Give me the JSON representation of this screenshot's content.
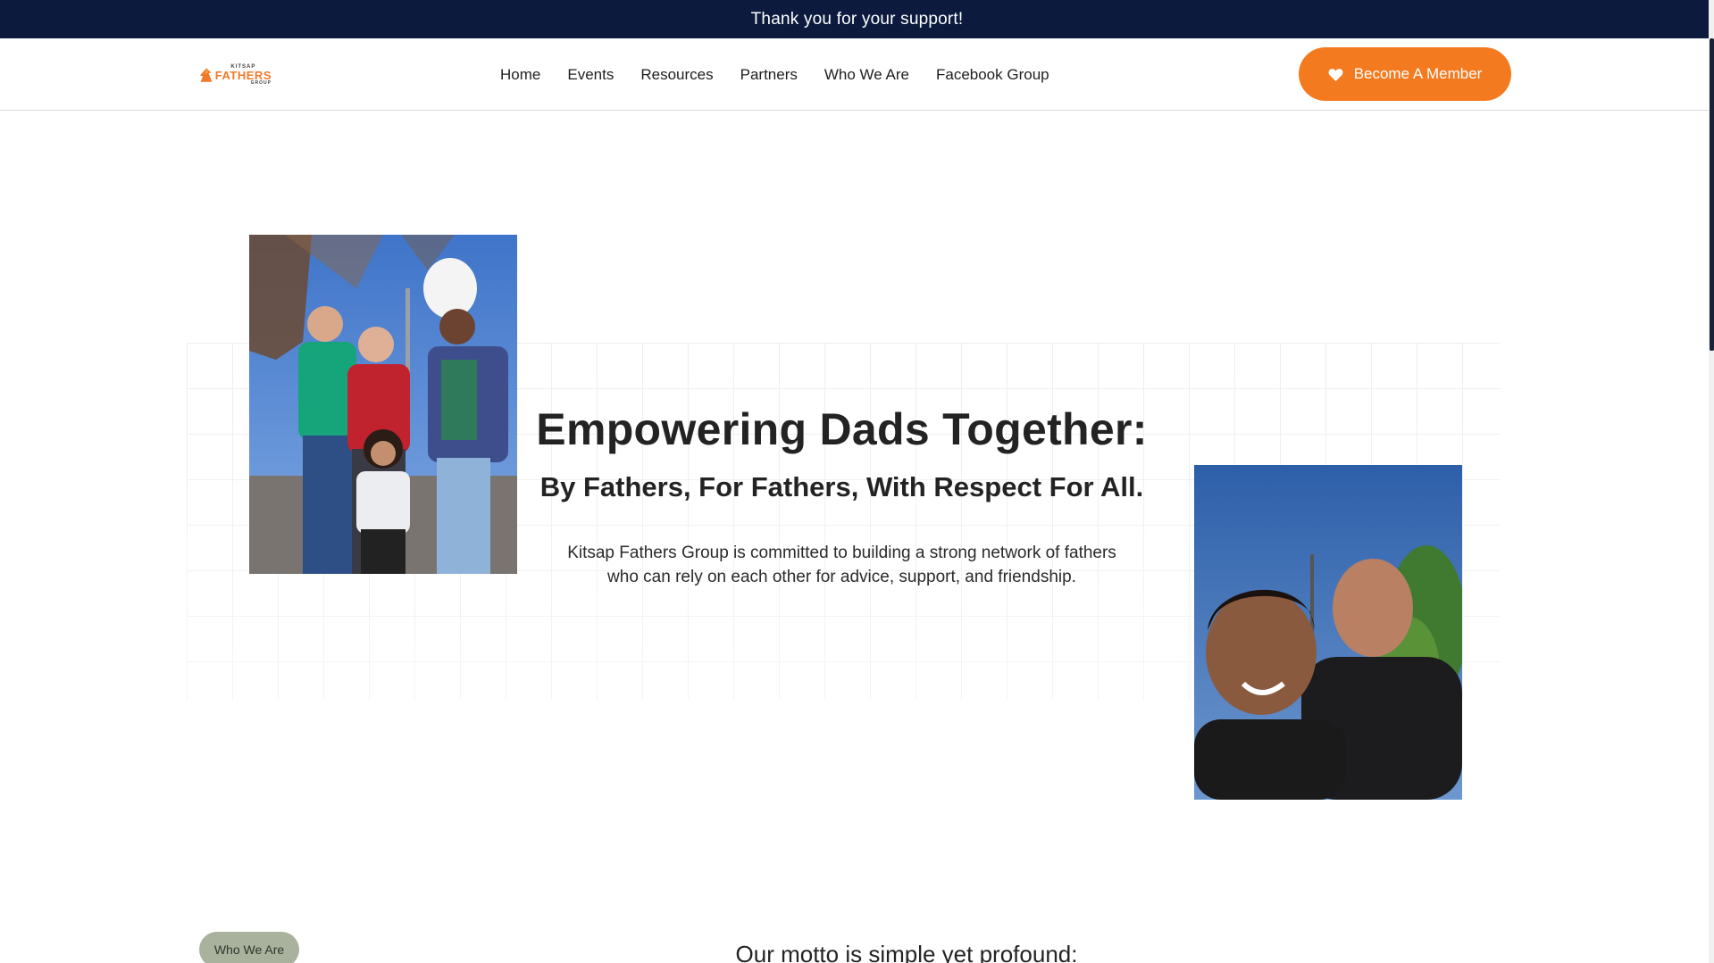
{
  "announcement": {
    "text": "Thank you for your support!"
  },
  "header": {
    "logo": {
      "top": "KITSAP",
      "main": "FATHERS",
      "bottom": "GROUP"
    },
    "nav": [
      "Home",
      "Events",
      "Resources",
      "Partners",
      "Who We Are",
      "Facebook Group"
    ],
    "cta": {
      "label": "Become A Member",
      "icon": "heart-icon"
    }
  },
  "hero": {
    "title": "Empowering Dads Together:",
    "subtitle": "By Fathers, For Fathers, With Respect For All.",
    "body": "Kitsap Fathers Group is committed to building a strong network of fathers who can rely on each other for advice, support, and friendship."
  },
  "about": {
    "tag": "Who We Are",
    "motto": "Our motto is simple yet profound:"
  },
  "colors": {
    "announcement_bg": "#0b1a3d",
    "accent": "#f47a20",
    "tag_bg": "#a9b29d"
  }
}
